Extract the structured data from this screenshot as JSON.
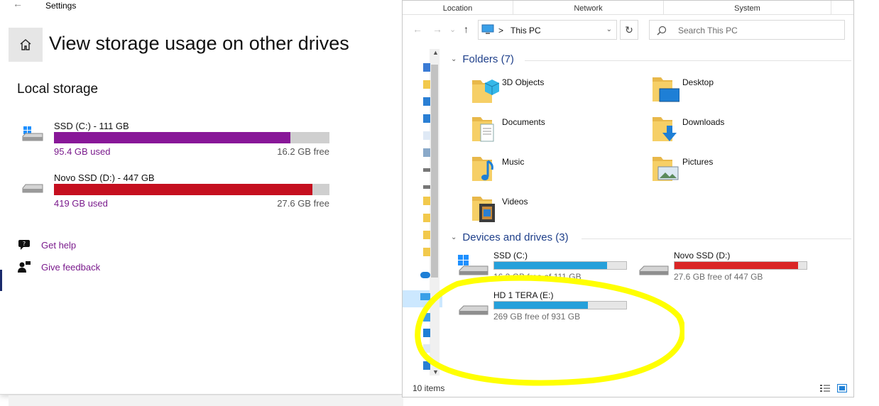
{
  "settings": {
    "window_title": "Settings",
    "back_glyph": "←",
    "home_icon": "home-icon",
    "page_title": "View storage usage on other drives",
    "section_title": "Local storage",
    "drives": [
      {
        "name": "SSD (C:) - 111 GB",
        "used": "95.4 GB used",
        "free": "16.2 GB free",
        "used_fraction": 0.859,
        "color": "#881798",
        "icon": "windows-drive-icon"
      },
      {
        "name": "Novo SSD (D:) - 447 GB",
        "used": "419 GB used",
        "free": "27.6 GB free",
        "used_fraction": 0.938,
        "color": "#c50f1f",
        "icon": "drive-icon"
      }
    ],
    "links": [
      {
        "label": "Get help",
        "icon": "help-chat-icon"
      },
      {
        "label": "Give feedback",
        "icon": "feedback-icon"
      }
    ]
  },
  "explorer": {
    "ribbon_tabs": [
      "Location",
      "Network",
      "System"
    ],
    "address": "This PC",
    "crumb_sep": ">",
    "search_placeholder": "Search This PC",
    "folders_group": "Folders (7)",
    "folders": [
      {
        "name": "3D Objects",
        "icon": "3d-objects-folder-icon"
      },
      {
        "name": "Desktop",
        "icon": "desktop-folder-icon"
      },
      {
        "name": "Documents",
        "icon": "documents-folder-icon"
      },
      {
        "name": "Downloads",
        "icon": "downloads-folder-icon"
      },
      {
        "name": "Music",
        "icon": "music-folder-icon"
      },
      {
        "name": "Pictures",
        "icon": "pictures-folder-icon"
      },
      {
        "name": "Videos",
        "icon": "videos-folder-icon"
      }
    ],
    "devices_group": "Devices and drives (3)",
    "drives": [
      {
        "name": "SSD (C:)",
        "free": "16.2 GB free of 111 GB",
        "used_fraction": 0.854,
        "color": "#26a0da",
        "icon": "windows-drive-icon"
      },
      {
        "name": "Novo SSD (D:)",
        "free": "27.6 GB free of 447 GB",
        "used_fraction": 0.938,
        "color": "#da2626",
        "icon": "drive-icon"
      },
      {
        "name": "HD 1 TERA (E:)",
        "free": "269 GB free of 931 GB",
        "used_fraction": 0.711,
        "color": "#26a0da",
        "icon": "drive-icon"
      }
    ],
    "status": "10 items"
  },
  "annotation": {
    "color": "#ffff00"
  }
}
